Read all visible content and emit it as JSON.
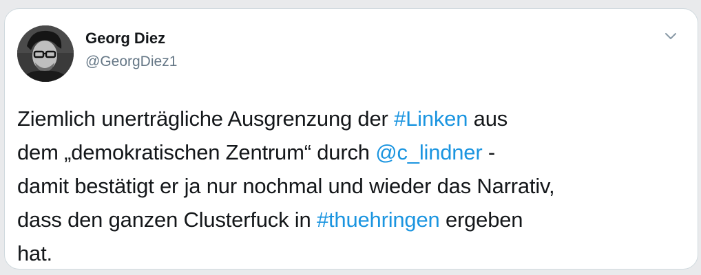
{
  "tweet": {
    "author": {
      "display_name": "Georg Diez",
      "handle": "@GeorgDiez1"
    },
    "menu_icon": "chevron-down-icon",
    "text": {
      "line1": {
        "pre": "Ziemlich unerträgliche Ausgrenzung der ",
        "hashtag": "#Linken",
        "post": " aus"
      },
      "line2": {
        "pre": "dem „demokratischen Zentrum“ durch ",
        "mention": "@c_lindner",
        "post": " -"
      },
      "line3": "damit bestätigt er ja nur nochmal und wieder das Narrativ,",
      "line4": {
        "pre": "dass den ganzen Clusterfuck in ",
        "hashtag": "#thuehringen",
        "post": " ergeben"
      },
      "line5": "hat."
    },
    "colors": {
      "link": "#1b95e0",
      "text": "#14171a",
      "secondary": "#657786"
    }
  }
}
